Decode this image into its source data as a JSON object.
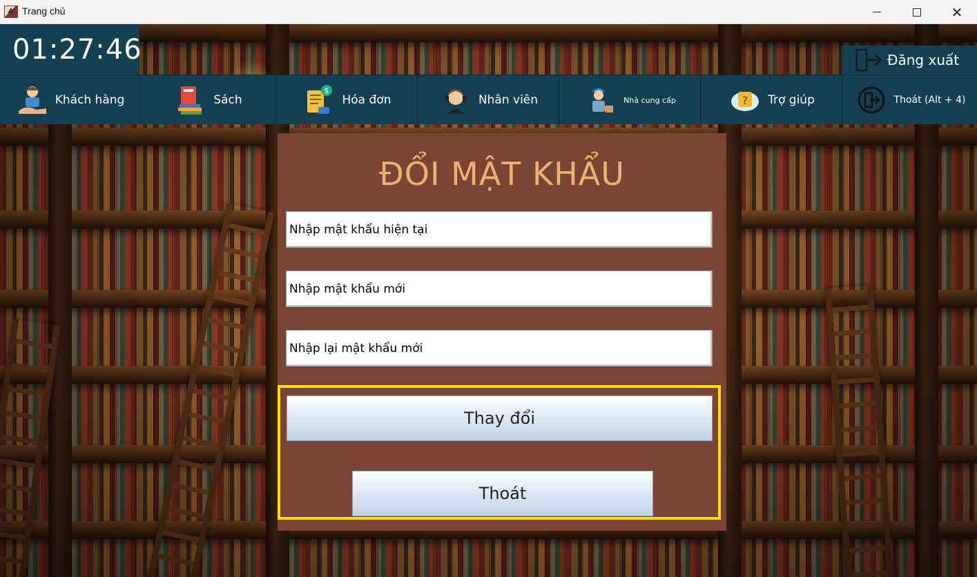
{
  "window": {
    "title": "Trang chủ",
    "controls": {
      "minimize": "minimize",
      "maximize": "maximize",
      "close": "✕"
    }
  },
  "clock": {
    "time": "01:27:46"
  },
  "logout": {
    "label": "Đăng xuất",
    "icon": "logout-door-icon"
  },
  "menu": {
    "items": [
      {
        "label": "Khách hàng",
        "icon": "customer-icon"
      },
      {
        "label": "Sách",
        "icon": "books-icon"
      },
      {
        "label": "Hóa đơn",
        "icon": "invoice-icon"
      },
      {
        "label": "Nhân viên",
        "icon": "staff-headset-icon"
      },
      {
        "label": "Nhà cung cấp",
        "icon": "supplier-icon"
      },
      {
        "label": "Trợ giúp",
        "icon": "help-icon"
      },
      {
        "label": "Thoát (Alt + 4)",
        "icon": "exit-icon"
      }
    ]
  },
  "dialog": {
    "title": "ĐỔI MẬT KHẨU",
    "current_password": {
      "placeholder": "Nhập mật khẩu hiện tại",
      "value": ""
    },
    "new_password": {
      "placeholder": "Nhập mật khẩu mới",
      "value": ""
    },
    "confirm_password": {
      "placeholder": "Nhập lại mật khẩu mới",
      "value": ""
    },
    "change_button": "Thay đổi",
    "exit_button": "Thoát"
  },
  "colors": {
    "nav_background": "#153f52",
    "dialog_background": "#7b4535",
    "title_color": "#f0b070",
    "highlight": "#f5e000"
  }
}
